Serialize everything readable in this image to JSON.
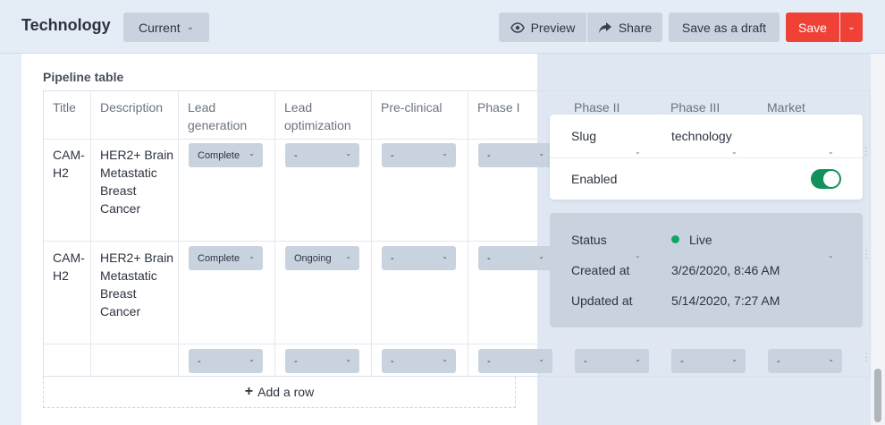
{
  "header": {
    "title": "Technology",
    "version_select": "Current",
    "preview_label": "Preview",
    "share_label": "Share",
    "draft_label": "Save as a draft",
    "save_label": "Save"
  },
  "pipeline": {
    "label": "Pipeline table",
    "columns": [
      "Title",
      "Description",
      "Lead generation",
      "Lead optimization",
      "Pre-clinical",
      "Phase I",
      "Phase II",
      "Phase III",
      "Market"
    ],
    "rows": [
      {
        "title": "CAM-H2",
        "description": "HER2+ Brain Metastatic Breast Cancer",
        "stages": [
          "Complete",
          "-",
          "-",
          "-",
          "-",
          "-",
          "-"
        ]
      },
      {
        "title": "CAM-H2",
        "description": "HER2+ Brain Metastatic Breast Cancer",
        "stages": [
          "Complete",
          "Ongoing",
          "-",
          "-",
          "-",
          "-",
          "-"
        ]
      },
      {
        "title": "",
        "description": "",
        "stages": [
          "-",
          "-",
          "-",
          "-",
          "-",
          "-",
          "-"
        ]
      }
    ],
    "add_row_label": "Add a row"
  },
  "meta": {
    "slug_label": "Slug",
    "slug_value": "technology",
    "enabled_label": "Enabled",
    "enabled": true,
    "status_label": "Status",
    "status_value": "Live",
    "created_label": "Created at",
    "created_value": "3/26/2020, 8:46 AM",
    "updated_label": "Updated at",
    "updated_value": "5/14/2020, 7:27 AM"
  },
  "colors": {
    "accent_save": "#ef4135",
    "toggle_on": "#12925b",
    "status_live": "#12a368"
  },
  "icons": [
    "chevron-down-icon",
    "eye-icon",
    "share-icon",
    "plus-icon",
    "drag-handle-icon"
  ]
}
